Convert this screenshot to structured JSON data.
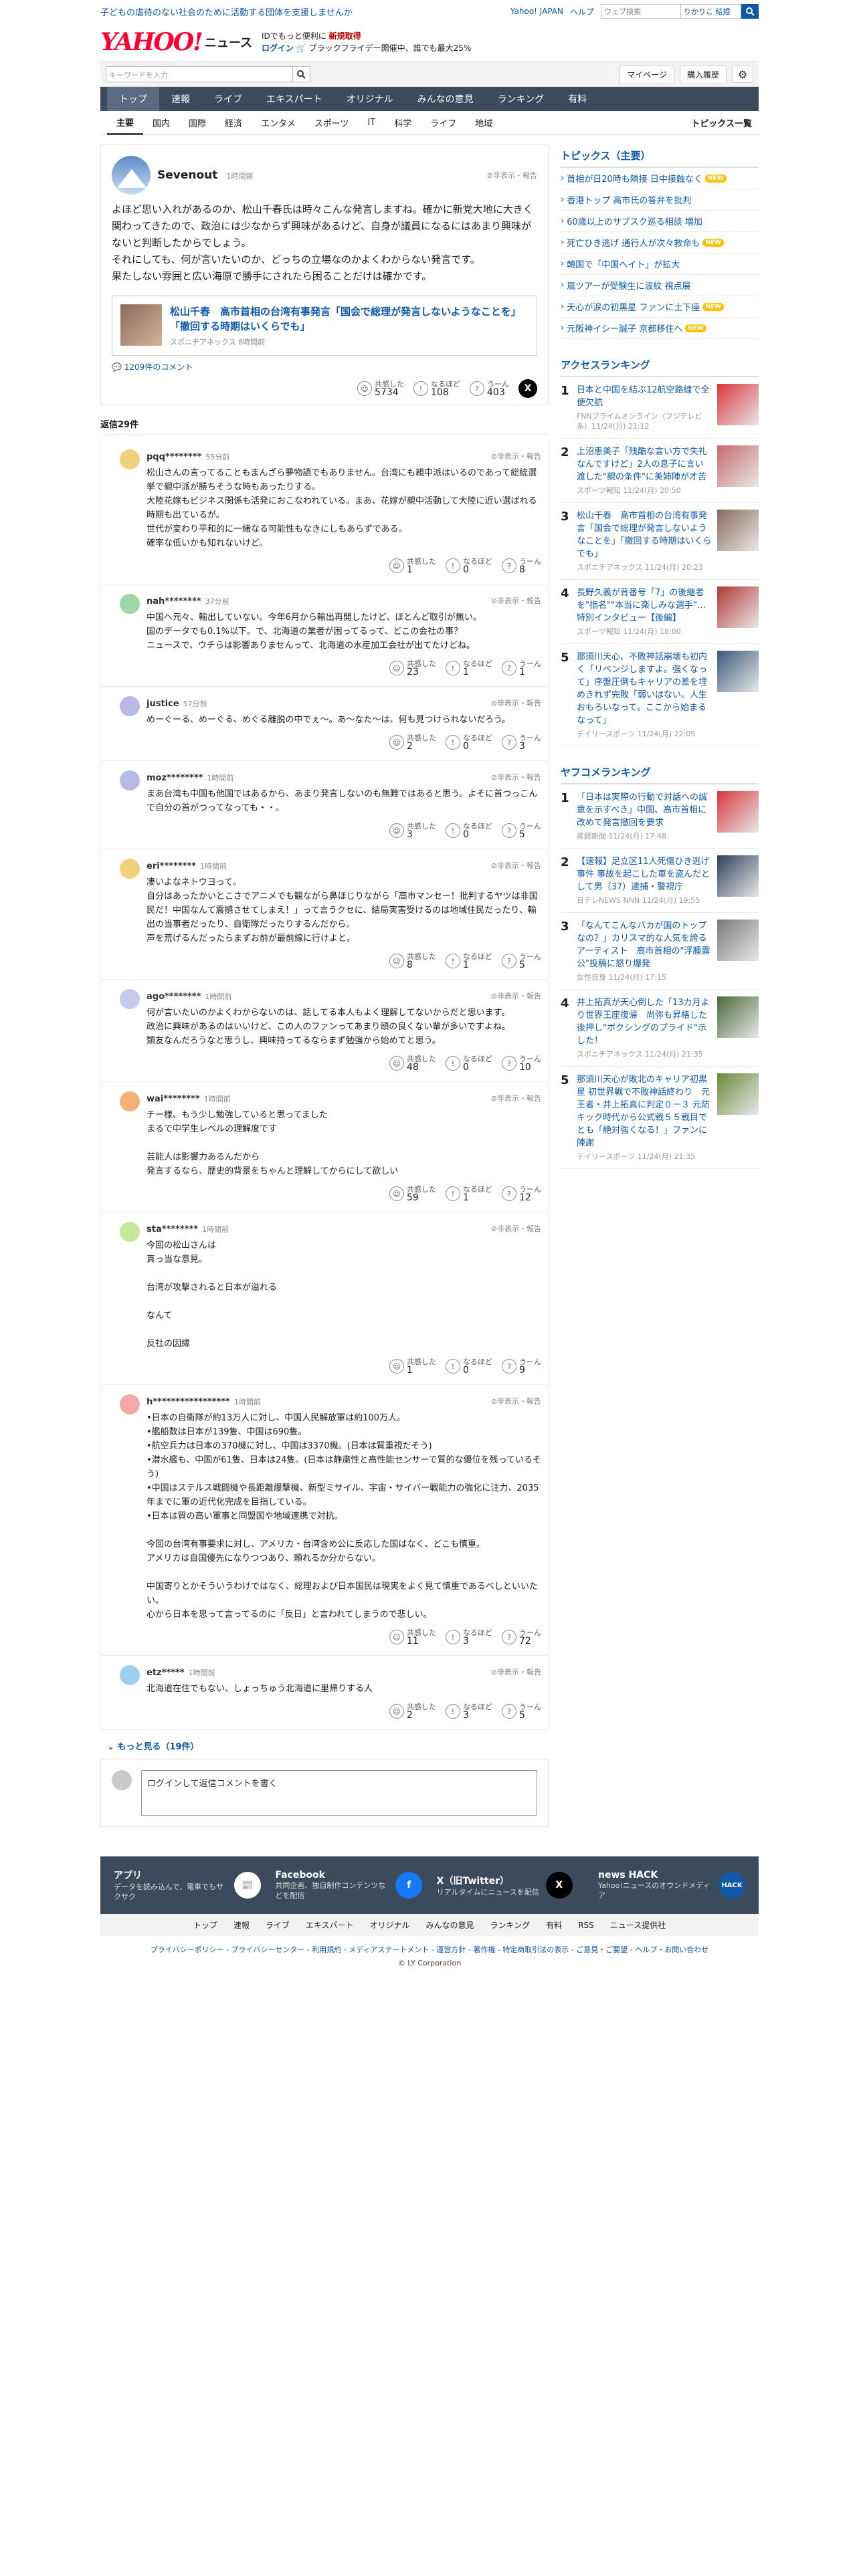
{
  "top": {
    "promo": "子どもの虐待のない社会のために活動する団体を支援しませんか",
    "links": [
      "Yahoo! JAPAN",
      "ヘルプ"
    ],
    "search_placeholder": "ウェブ検索",
    "search_extra": "りかりこ 結婚"
  },
  "logo": {
    "yahoo": "YAHOO!",
    "sub": "JAPAN",
    "news": "ニュース"
  },
  "tagline": {
    "line1a": "IDでもっと便利に",
    "line1b": "新規取得",
    "line2a": "ログイン",
    "line2b": "🛒 ブラックフライデー開催中、誰でも最大25%"
  },
  "graybar": {
    "kw_placeholder": "キーワードを入力",
    "mypage": "マイページ",
    "history": "購入履歴"
  },
  "nav": [
    "トップ",
    "速報",
    "ライブ",
    "エキスパート",
    "オリジナル",
    "みんなの意見",
    "ランキング",
    "有料"
  ],
  "subnav": [
    "主要",
    "国内",
    "国際",
    "経済",
    "エンタメ",
    "スポーツ",
    "IT",
    "科学",
    "ライフ",
    "地域"
  ],
  "subnav_list": "トピックス一覧",
  "post": {
    "user": "Sevenout",
    "ago": "1時間前",
    "report": "非表示・報告",
    "body": "よほど思い入れがあるのか、松山千春氏は時々こんな発言しますね。確かに新党大地に大きく関わってきたので、政治には少なからず興味があるけど、自身が議員になるにはあまり興味がないと判断したからでしょう。\nそれにしても、何が言いたいのか、どっちの立場なのかよくわからない発言です。\n果たしない雰囲と広い海原で勝手にされたら困ることだけは確かです。",
    "quoted_title": "松山千春　高市首相の台湾有事発言「国会で総理が発言しないようなことを」「撤回する時期はいくらでも」",
    "quoted_source": "スポニチアネックス 8時間前",
    "comment_link": "1209件のコメント",
    "reactions": [
      {
        "label": "共感した",
        "count": "5734"
      },
      {
        "label": "なるほど",
        "count": "108"
      },
      {
        "label": "うーん",
        "count": "403"
      }
    ]
  },
  "reply_header": "返信29件",
  "replies": [
    {
      "name": "pqq********",
      "ago": "55分前",
      "color": "#f0d27a",
      "body": "松山さんの言ってることもまんざら夢物語でもありません。台湾にも親中派はいるのであって総統選挙で親中派が勝ちそうな時もあったりする。\n大陸花嫁もビジネス関係も活発におこなわれている。まあ、花嫁が親中活動して大陸に近い選ばれる時期も出ているが。\n世代が変わり平和的に一緒なる可能性もなきにしもあらずである。\n確率な低いかも知れないけど。",
      "r": [
        "1",
        "0",
        "8"
      ]
    },
    {
      "name": "nah********",
      "ago": "37分前",
      "color": "#9fd7a8",
      "body": "中国へ元々、輸出していない。今年6月から輸出再開したけど、ほとんど取引が無い。\n国のデータでも0.1%以下。で、北海道の業者が困ってるって、どこの会社の事？\nニュースで、ウチらは影響ありませんって、北海道の水産加工会社が出てたけどね。",
      "r": [
        "23",
        "1",
        "1"
      ]
    },
    {
      "name": "justice",
      "ago": "57分前",
      "color": "#b9b9e6",
      "body": "めーぐーる、めーぐる、めぐる離脱の中でぇ〜。あ〜なた〜は、何も見つけられないだろう。",
      "r": [
        "2",
        "0",
        "3"
      ]
    },
    {
      "name": "moz********",
      "ago": "1時間前",
      "color": "#b9b9e6",
      "body": "まあ台湾も中国も他国ではあるから、あまり発言しないのも無難ではあると思う。よそに首つっこんで自分の首がつってなっても・・。",
      "r": [
        "3",
        "0",
        "5"
      ]
    },
    {
      "name": "eri********",
      "ago": "1時間前",
      "color": "#f0d27a",
      "body": "凄いよなネトウヨって。\n自分はあったかいとこさでアニメでも観ながら鼻ほじりながら「高市マンセー！批判するヤツは非国民だ！中国なんて震撼させてしまえ！」って言うクセに、結局実害受けるのは地域住民だったり、輸出の当事者だったり、自衛隊だったりするんだから。\n声を荒げるんだったらまずお前が最前線に行けよと。",
      "r": [
        "8",
        "1",
        "5"
      ]
    },
    {
      "name": "ago********",
      "ago": "1時間前",
      "color": "#c9c9ef",
      "body": "何が言いたいのかよくわからないのは、話してる本人もよく理解してないからだと思います。\n政治に興味があるのはいいけど、この人のファンってあまり頭の良くない輩が多いですよね。\n類友なんだろうなと思うし、興味持ってるならまず勉強から始めてと思う。",
      "r": [
        "48",
        "0",
        "10"
      ]
    },
    {
      "name": "wai********",
      "ago": "1時間前",
      "color": "#f5b07a",
      "body": "チー様、もう少し勉強していると思ってました\nまるで中学生レベルの理解度です\n\n芸能人は影響力あるんだから\n発言するなら、歴史的背景をちゃんと理解してからにして欲しい",
      "r": [
        "59",
        "1",
        "12"
      ]
    },
    {
      "name": "sta********",
      "ago": "1時間前",
      "color": "#c6e79a",
      "body": "今回の松山さんは\n真っ当な意見。\n\n台湾が攻撃されると日本が溢れる\n\nなんて\n\n反社の因縁",
      "r": [
        "1",
        "0",
        "9"
      ]
    },
    {
      "name": "h*****************",
      "ago": "1時間前",
      "color": "#f5a8a8",
      "body": "•日本の自衛隊が約13万人に対し、中国人民解放軍は約100万人。\n•艦船数は日本が139隻、中国は690隻。\n•航空兵力は日本の370機に対し、中国は3370機。(日本は質重視だそう)\n•潜水艦も、中国が61隻、日本は24隻。(日本は静粛性と高性能センサーで質的な優位を残っているそう)\n•中国はステルス戦闘機や長距離爆撃機、新型ミサイル、宇宙・サイバー戦能力の強化に注力、2035年までに軍の近代化完成を目指している。\n•日本は質の高い軍事と同盟国や地域連携で対抗。\n\n今回の台湾有事要求に対し、アメリカ・台湾含め公に反応した国はなく、どこも慎重。\nアメリカは自国優先になりつつあり、頼れるか分からない。\n\n中国寄りとかそういうわけではなく、総理および日本国民は現実をよく見て慎重であるべしといいたい。\n心から日本を思って言ってるのに「反日」と言われてしまうので悲しい。",
      "r": [
        "11",
        "3",
        "72"
      ]
    },
    {
      "name": "etz*****",
      "ago": "1時間前",
      "color": "#9fd0ee",
      "body": "北海道在住でもない、しょっちゅう北海道に里帰りする人",
      "r": [
        "2",
        "3",
        "5"
      ]
    }
  ],
  "reply_reacts": [
    "共感した",
    "なるほど",
    "うーん"
  ],
  "more_label": "もっと見る（19件）",
  "comment_placeholder": "ログインして返信コメントを書く",
  "sidebar": {
    "topics_header": "トピックス（主要）",
    "topics": [
      {
        "t": "首相が日20時も隣接 日中接触なく",
        "new": true
      },
      {
        "t": "香港トップ 高市氏の答弁を批判",
        "new": false
      },
      {
        "t": "60歳以上のサブスク巡る相談 増加",
        "new": false
      },
      {
        "t": "死亡ひき逃げ 通行人が次々救命も",
        "new": true
      },
      {
        "t": "韓国で「中国ヘイト」が拡大",
        "new": false
      },
      {
        "t": "嵐ツアーが受験生に波紋 視点展",
        "new": false
      },
      {
        "t": "天心が涙の初黒星 ファンに土下座",
        "new": true
      },
      {
        "t": "元阪神イシー誠子 京都移住へ",
        "new": true
      }
    ],
    "new_badge": "NEW",
    "access_header": "アクセスランキング",
    "access": [
      {
        "no": "1",
        "t": "日本と中国を結ぶ12航空路線で全便欠航",
        "s": "FNNプライムオンライン（フジテレビ系）11/24(月) 21:12",
        "c": "#d9363e"
      },
      {
        "no": "2",
        "t": "上沼恵美子「残酷な言い方で失礼なんですけど」2人の息子に言い渡した\"親の条件\"に美姉陣が才苦",
        "s": "スポーツ報知 11/24(月) 20:50",
        "c": "#c86a6a"
      },
      {
        "no": "3",
        "t": "松山千春　高市首相の台湾有事発言「国会で総理が発言しないようなことを」「撤回する時期はいくらでも」",
        "s": "スポニチアネックス 11/24(月) 20:23",
        "c": "#8a6a5a"
      },
      {
        "no": "4",
        "t": "長野久義が背番号「7」の後継者を\"指名\"\"本当に楽しみな選手\"…特別インタビュー【後編】",
        "s": "スポーツ報知 11/24(月) 18:00",
        "c": "#b23636"
      },
      {
        "no": "5",
        "t": "那須川天心、不敗神話崩壊も初内く「リベンジしますよ。強くなって」序盤圧倒もキャリアの差を埋めきれず完敗「弱いはない。人生おもろいなって。ここから始まるなって」",
        "s": "デイリースポーツ 11/24(月) 22:05",
        "c": "#3a5a7a"
      }
    ],
    "yafoo_header": "ヤフコメランキング",
    "yafoo": [
      {
        "no": "1",
        "t": "「日本は実際の行動で対話への誠意を示すべき」中国、高市首相に改めて発言撤回を要求",
        "s": "産経新聞 11/24(月) 17:48",
        "c": "#d9363e"
      },
      {
        "no": "2",
        "t": "【速報】足立区11人死傷ひき逃げ事件 事故を起こした車を盗んだとして男（37）逮捕・警視庁",
        "s": "日テレNEWS NNN 11/24(月) 19:55",
        "c": "#2d3f5c"
      },
      {
        "no": "3",
        "t": "「なんてこんなバカが国のトップなの？」カリスマ的な人気を誇るアーティスト　高市首相の\"浮腫露公\"投稿に怒り爆発",
        "s": "女性自身 11/24(月) 17:15",
        "c": "#7a7a7a"
      },
      {
        "no": "4",
        "t": "井上拓真が天心倒した「13カ月より世界王座復帰　尚弥も昇格した後押し\"ボクシングのプライド\"示した！",
        "s": "スポニチアネックス 11/24(月) 21:35",
        "c": "#4a6a3a"
      },
      {
        "no": "5",
        "t": "那須川天心が敗北のキャリア初黒星 初世界戦で不敗神話終わり　元王者・井上拓真に判定０－３ 元防キック時代から公式戦５５戦目でとも「絶対強くなる！」ファンに陳謝",
        "s": "デイリースポーツ 11/24(月) 21:35",
        "c": "#6a8a3a"
      }
    ]
  },
  "footer": {
    "cols": [
      {
        "t": "アプリ",
        "d": "データを読み込んで、電車でもサクサク",
        "icon": "📰",
        "bg": "#ffffff",
        "fg": "#3c4a5e"
      },
      {
        "t": "Facebook",
        "d": "共同企画、独自制作コンテンツなどを配信",
        "icon": "f",
        "bg": "#1877f2",
        "fg": "#ffffff"
      },
      {
        "t": "X（旧Twitter）",
        "d": "リアルタイムにニュースを配信",
        "icon": "X",
        "bg": "#000000",
        "fg": "#ffffff"
      },
      {
        "t": "news HACK",
        "d": "Yahoo!ニュースのオウンドメディア",
        "icon": "HACK",
        "bg": "#0f58a6",
        "fg": "#ffffff"
      }
    ],
    "nav": [
      "トップ",
      "速報",
      "ライブ",
      "エキスパート",
      "オリジナル",
      "みんなの意見",
      "ランキング",
      "有料",
      "RSS",
      "ニュース提供社"
    ],
    "links": "プライバシーポリシー - プライバシーセンター - 利用規約 - メディアステートメント - 運営方針 - 著作権 - 特定商取引法の表示 - ご意見・ご要望 - ヘルプ・お問い合わせ",
    "copyright": "© LY Corporation"
  }
}
